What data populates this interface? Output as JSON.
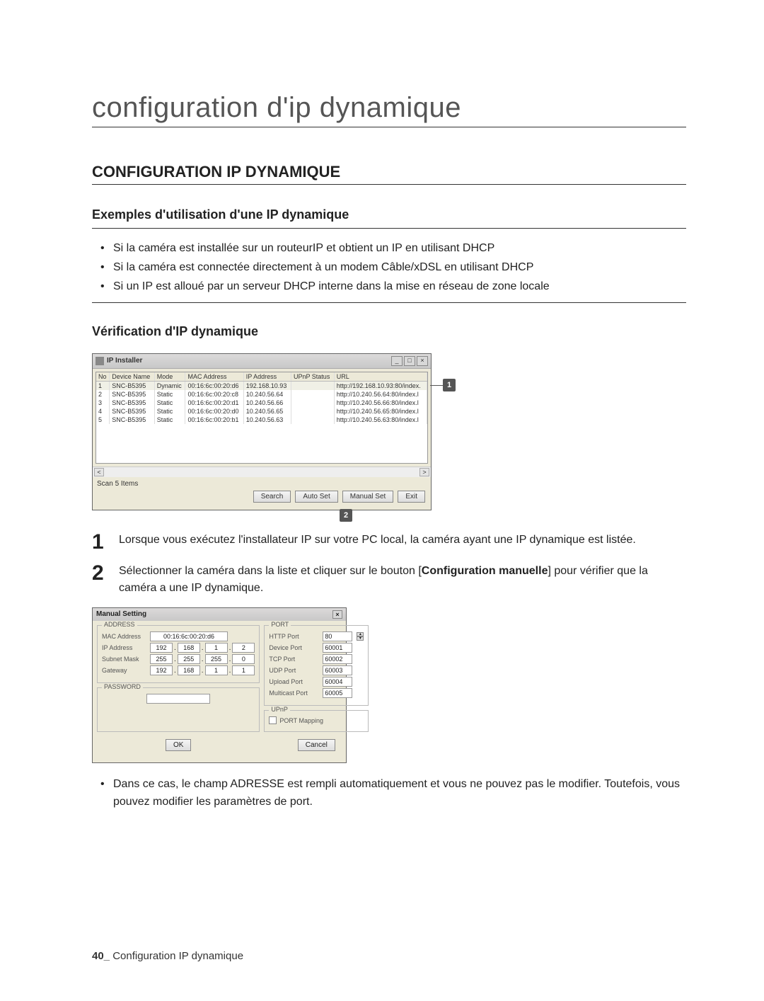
{
  "page": {
    "title": "configuration d'ip dynamique",
    "section_heading": "CONFIGURATION IP DYNAMIQUE",
    "sub1": "Exemples d'utilisation d'une IP dynamique",
    "bullets": [
      "Si la caméra est installée sur un routeurIP et obtient un IP en utilisant DHCP",
      "Si la caméra est connectée directement à un modem Câble/xDSL en utilisant DHCP",
      "Si un IP est alloué par un serveur DHCP interne dans la mise en réseau de zone locale"
    ],
    "sub2": "Vérification d'IP dynamique",
    "callouts": {
      "c1": "1",
      "c2": "2"
    },
    "steps": {
      "s1_num": "1",
      "s1_text": "Lorsque vous exécutez l'installateur IP sur votre PC local, la caméra ayant une IP dynamique est listée.",
      "s2_num": "2",
      "s2_text_pre": "Sélectionner la caméra dans la liste et cliquer sur le bouton [",
      "s2_text_bold": "Configuration manuelle",
      "s2_text_post": "] pour vérifier que la caméra a une IP dynamique."
    },
    "note": "Dans ce cas, le champ ADRESSE est rempli automatiquement et vous ne pouvez pas le modifier. Toutefois, vous pouvez modifier les paramètres de port.",
    "footer_page": "40_",
    "footer_text": " Configuration IP dynamique"
  },
  "ipinstaller": {
    "title": "IP Installer",
    "columns": [
      "No",
      "Device Name",
      "Mode",
      "MAC Address",
      "IP Address",
      "UPnP Status",
      "URL"
    ],
    "rows": [
      {
        "no": "1",
        "name": "SNC-B5395",
        "mode": "Dynamic",
        "mac": "00:16:6c:00:20:d6",
        "ip": "192.168.10.93",
        "upnp": "",
        "url": "http://192.168.10.93:80/index.",
        "sel": true
      },
      {
        "no": "2",
        "name": "SNC-B5395",
        "mode": "Static",
        "mac": "00:16:6c:00:20:c8",
        "ip": "10.240.56.64",
        "upnp": "",
        "url": "http://10.240.56.64:80/index.l"
      },
      {
        "no": "3",
        "name": "SNC-B5395",
        "mode": "Static",
        "mac": "00:16:6c:00:20:d1",
        "ip": "10.240.56.66",
        "upnp": "",
        "url": "http://10.240.56.66:80/index.l"
      },
      {
        "no": "4",
        "name": "SNC-B5395",
        "mode": "Static",
        "mac": "00:16:6c:00:20:d0",
        "ip": "10.240.56.65",
        "upnp": "",
        "url": "http://10.240.56.65:80/index.l"
      },
      {
        "no": "5",
        "name": "SNC-B5395",
        "mode": "Static",
        "mac": "00:16:6c:00:20:b1",
        "ip": "10.240.56.63",
        "upnp": "",
        "url": "http://10.240.56.63:80/index.l"
      }
    ],
    "status": "Scan 5 Items",
    "buttons": {
      "search": "Search",
      "autoset": "Auto Set",
      "manualset": "Manual Set",
      "exit": "Exit"
    }
  },
  "manual": {
    "title": "Manual Setting",
    "close": "×",
    "address_legend": "ADDRESS",
    "mac_label": "MAC Address",
    "mac_value": "00:16:6c:00:20:d6",
    "ip_label": "IP Address",
    "ip_value": [
      "192",
      "168",
      "1",
      "2"
    ],
    "subnet_label": "Subnet Mask",
    "subnet_value": [
      "255",
      "255",
      "255",
      "0"
    ],
    "gateway_label": "Gateway",
    "gateway_value": [
      "192",
      "168",
      "1",
      "1"
    ],
    "password_legend": "PASSWORD",
    "port_legend": "PORT",
    "ports": {
      "http": {
        "label": "HTTP Port",
        "value": "80"
      },
      "device": {
        "label": "Device Port",
        "value": "60001"
      },
      "tcp": {
        "label": "TCP Port",
        "value": "60002"
      },
      "udp": {
        "label": "UDP Port",
        "value": "60003"
      },
      "upload": {
        "label": "Upload Port",
        "value": "60004"
      },
      "multicast": {
        "label": "Multicast Port",
        "value": "60005"
      }
    },
    "upnp_legend": "UPnP",
    "upnp_check": "PORT Mapping",
    "ok": "OK",
    "cancel": "Cancel"
  }
}
